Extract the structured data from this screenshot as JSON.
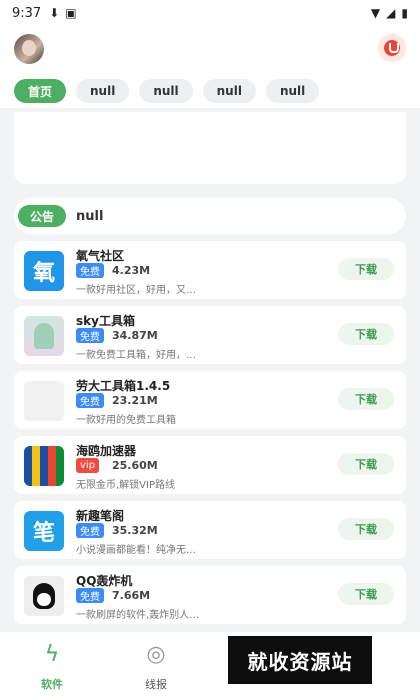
{
  "status": {
    "time": "9:37"
  },
  "tabs": [
    "首页",
    "null",
    "null",
    "null",
    "null"
  ],
  "notice": {
    "badge": "公告",
    "text": "null"
  },
  "apps": [
    {
      "name": "氧气社区",
      "tag": "免费",
      "tag_type": "free",
      "size": "4.23M",
      "desc": "一款好用社区，好用，又…",
      "btn": "下载",
      "icon": "qq1-icon",
      "glyph": "氧"
    },
    {
      "name": "sky工具箱",
      "tag": "免费",
      "tag_type": "free",
      "size": "34.87M",
      "desc": "一款免费工具箱，好用，…",
      "btn": "下载",
      "icon": "sky-icon"
    },
    {
      "name": "劳大工具箱1.4.5",
      "tag": "免费",
      "tag_type": "free",
      "size": "23.21M",
      "desc": "一款好用的免费工具箱",
      "btn": "下载",
      "icon": "blank-icon"
    },
    {
      "name": "海鸥加速器",
      "tag": "vip",
      "tag_type": "vip",
      "size": "25.60M",
      "desc": "无限金币,解锁VIP路线",
      "btn": "下载",
      "icon": "hai-icon"
    },
    {
      "name": "新趣笔阁",
      "tag": "免费",
      "tag_type": "free",
      "size": "35.32M",
      "desc": "小说漫画都能看！纯净无…",
      "btn": "下载",
      "icon": "bi-icon",
      "glyph": "笔"
    },
    {
      "name": "QQ轰炸机",
      "tag": "免费",
      "tag_type": "free",
      "size": "7.66M",
      "desc": "一款刷屏的软件,轰炸别人…",
      "btn": "下载",
      "icon": "qq-icon"
    }
  ],
  "bottom_nav": {
    "software": "软件",
    "news": "线报"
  },
  "watermark": "就收资源站",
  "colors": {
    "accent": "#4caf62",
    "free": "#3d8bf5",
    "vip": "#ef4b43"
  }
}
